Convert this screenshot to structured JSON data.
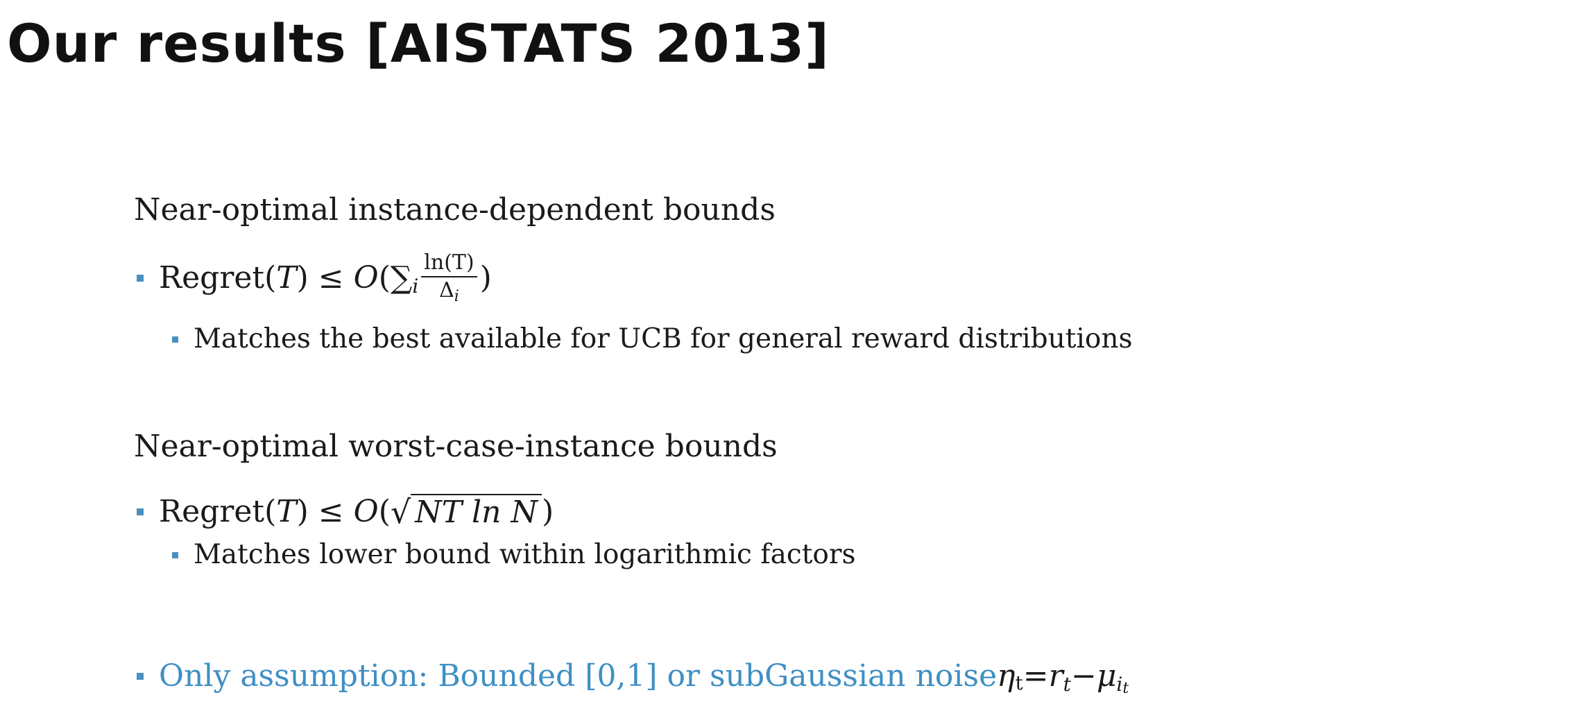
{
  "slide": {
    "title": "Our results [AISTATS 2013]",
    "section1": {
      "heading": "Near-optimal instance-dependent bounds",
      "bullet": {
        "prefix": "Regret(",
        "var_T": "T",
        "after_T": ") ≤ ",
        "big_o": "O",
        "open_paren": "(",
        "sum": "∑",
        "sum_sub": "i",
        "frac_num": "ln(T)",
        "frac_den_delta": "Δ",
        "frac_den_sub": "i",
        "close_paren": ")"
      },
      "sub_bullet": "Matches the best available for UCB for general reward distributions"
    },
    "section2": {
      "heading": "Near-optimal worst-case-instance bounds",
      "bullet": {
        "prefix": "Regret(",
        "var_T": "T",
        "after_T": ") ≤ ",
        "big_o": "O",
        "open_paren": "(",
        "sqrt_sign": "√",
        "sqrt_body": "NT ln N",
        "close_paren": " )"
      },
      "sub_bullet": "Matches lower bound within logarithmic factors"
    },
    "assumption": {
      "text": "Only assumption: Bounded [0,1] or subGaussian noise ",
      "eta": "η",
      "eta_sub": "t",
      "eq": " = ",
      "r": "r",
      "r_sub": "t",
      "minus": " − ",
      "mu": "μ",
      "mu_sub": "i",
      "mu_subsub": "t"
    },
    "colors": {
      "bullet": "#4a90c0",
      "accent_text": "#3f8fc4",
      "text": "#1a1a1a"
    }
  }
}
